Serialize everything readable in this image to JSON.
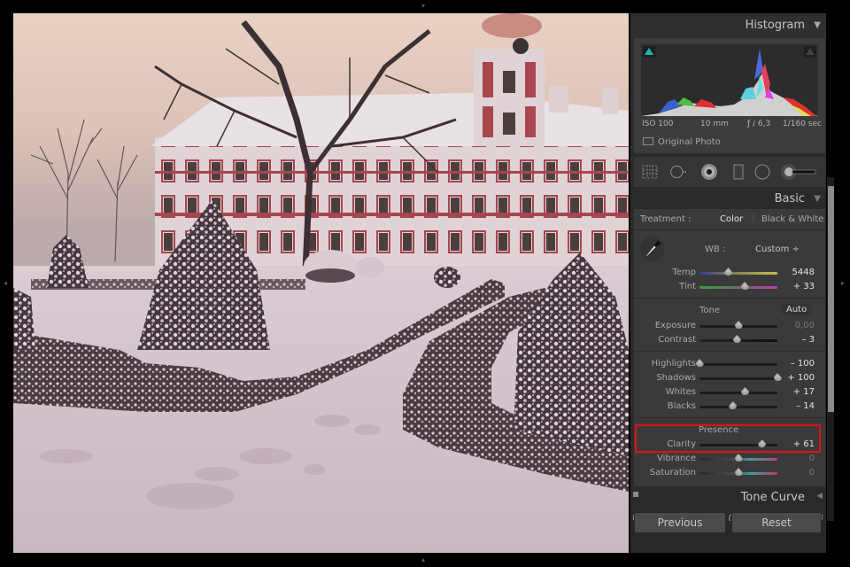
{
  "app": {
    "name": "Lightroom Develop module"
  },
  "photo": {
    "alt": "Snow-covered formal garden with topiary cones and low hedges in front of a red-and-white baroque chateau with a clock tower at dusk",
    "colors": {
      "sky_top": "#e8cfc3",
      "sky_low": "#b9a9ae",
      "snow": "#d3c4cc",
      "facade_red": "#a8464f",
      "facade_white": "#e2d6d8",
      "hedge": "#4a3b3f"
    }
  },
  "edge_arrows": {
    "top": "▾",
    "bottom": "▴",
    "left": "◂",
    "right": "▸"
  },
  "histogram": {
    "title": "Histogram",
    "collapse_icon": "▼",
    "shadow_clip_color": "#1fb5b5",
    "highlight_clip_color": "#3a3a3a",
    "exif": {
      "iso": "ISO 100",
      "focal": "10 mm",
      "aperture": "ƒ / 6,3",
      "shutter": "1/160 sec"
    },
    "original_photo_label": "Original Photo"
  },
  "tools": [
    {
      "name": "crop-overlay-icon"
    },
    {
      "name": "spot-removal-icon"
    },
    {
      "name": "red-eye-icon"
    },
    {
      "name": "graduated-filter-icon"
    },
    {
      "name": "radial-filter-icon"
    },
    {
      "name": "adjustment-brush-icon"
    }
  ],
  "basic": {
    "title": "Basic",
    "collapse_icon": "▼",
    "treatment_label": "Treatment :",
    "treatment_options": [
      "Color",
      "Black & White"
    ],
    "treatment_selected": "Color",
    "wb_label": "WB :",
    "wb_value": "Custom ÷",
    "temp": {
      "label": "Temp",
      "value": "5448",
      "position": 0.37
    },
    "tint": {
      "label": "Tint",
      "value": "+ 33",
      "position": 0.58
    },
    "tone_label": "Tone",
    "auto_label": "Auto",
    "exposure": {
      "label": "Exposure",
      "value": "0,00",
      "position": 0.5
    },
    "contrast": {
      "label": "Contrast",
      "value": "– 3",
      "position": 0.48
    },
    "highlights": {
      "label": "Highlights",
      "value": "– 100",
      "position": 0.0
    },
    "shadows": {
      "label": "Shadows",
      "value": "+ 100",
      "position": 1.0
    },
    "whites": {
      "label": "Whites",
      "value": "+ 17",
      "position": 0.585
    },
    "blacks": {
      "label": "Blacks",
      "value": "– 14",
      "position": 0.43
    },
    "presence_label": "Presence",
    "clarity": {
      "label": "Clarity",
      "value": "+ 61",
      "position": 0.805
    },
    "vibrance": {
      "label": "Vibrance",
      "value": "0",
      "position": 0.5
    },
    "saturation": {
      "label": "Saturation",
      "value": "0",
      "position": 0.5
    },
    "highlight_color": "#e0111b"
  },
  "tone_curve": {
    "title": "Tone Curve",
    "collapse_icon": "◀"
  },
  "hsl": {
    "title": "HSL  /  Color  /  B & W",
    "collapse_icon": "◀"
  },
  "buttons": {
    "previous": "Previous",
    "reset": "Reset"
  }
}
